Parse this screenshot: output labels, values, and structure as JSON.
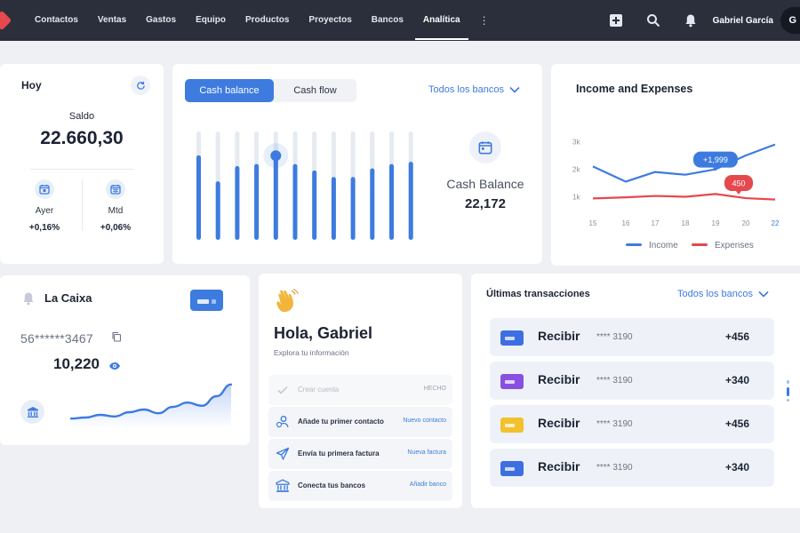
{
  "colors": {
    "accent": "#3d7bdf",
    "income": "#3d7bdf",
    "expenses": "#e5484d",
    "topbar": "#2a2f3b"
  },
  "nav": {
    "items": [
      "Contactos",
      "Ventas",
      "Gastos",
      "Equipo",
      "Productos",
      "Proyectos",
      "Bancos",
      "Analítica"
    ],
    "active": "Analítica",
    "more_icon": "more-vertical-icon"
  },
  "topbar": {
    "icons": [
      "add-icon",
      "search-icon",
      "bell-icon"
    ],
    "user_name": "Gabriel García",
    "avatar_initial": "G"
  },
  "hoy": {
    "title": "Hoy",
    "refresh_icon": "refresh-icon",
    "saldo_label": "Saldo",
    "saldo_value": "22.660,30",
    "stats": [
      {
        "label": "Ayer",
        "value": "+0,16%",
        "icon": "calendar-icon"
      },
      {
        "label": "Mtd",
        "value": "+0,06%",
        "icon": "calendar-grid-icon"
      }
    ]
  },
  "cash": {
    "tabs": [
      "Cash balance",
      "Cash flow"
    ],
    "active_tab": "Cash balance",
    "banks_dropdown": "Todos los bancos",
    "label": "Cash Balance",
    "value": "22,172",
    "bar_levels": [
      0.78,
      0.54,
      0.68,
      0.7,
      0.76,
      0.7,
      0.64,
      0.58,
      0.58,
      0.66,
      0.7,
      0.72
    ],
    "highlighted_bar": 4
  },
  "income": {
    "title": "Income and Expenses",
    "chart_data": {
      "type": "line",
      "x": [
        15,
        16,
        17,
        18,
        19,
        20,
        22
      ],
      "yticks": [
        "3k",
        "2k",
        "1k"
      ],
      "ylim": [
        500,
        3500
      ],
      "series": [
        {
          "name": "Income",
          "values": [
            2100,
            1550,
            1900,
            1800,
            1999,
            2500,
            2900
          ]
        },
        {
          "name": "Expenses",
          "values": [
            940,
            980,
            1030,
            1000,
            1100,
            950,
            900
          ]
        }
      ],
      "annotations": [
        "+1,999",
        "450"
      ],
      "legend": "bottom"
    }
  },
  "caixa": {
    "title": "La Caixa",
    "account": "56******3467",
    "balance": "10,220",
    "sparkline": [
      0.18,
      0.2,
      0.25,
      0.22,
      0.3,
      0.35,
      0.28,
      0.4,
      0.48,
      0.42,
      0.6,
      0.82
    ]
  },
  "hola": {
    "title": "Hola, Gabriel",
    "subtitle": "Explora tu información",
    "tasks": [
      {
        "label": "Crear cuenta",
        "action": "HECHO",
        "icon": "check-icon",
        "done": true
      },
      {
        "label": "Añade tu primer contacto",
        "action": "Nuevo contacto",
        "icon": "contacts-icon",
        "done": false
      },
      {
        "label": "Envía tu primera factura",
        "action": "Nueva factura",
        "icon": "send-icon",
        "done": false
      },
      {
        "label": "Conecta tus bancos",
        "action": "Añadir banco",
        "icon": "bank-icon",
        "done": false
      }
    ]
  },
  "transactions": {
    "title": "Últimas transacciones",
    "banks_dropdown": "Todos los bancos",
    "rows": [
      {
        "type": "Recibir",
        "account": "**** 3190",
        "amount": "+456",
        "card_color": "#3d6fe0"
      },
      {
        "type": "Recibir",
        "account": "**** 3190",
        "amount": "+340",
        "card_color": "#8a4fe0"
      },
      {
        "type": "Recibir",
        "account": "**** 3190",
        "amount": "+456",
        "card_color": "#f2c12e"
      },
      {
        "type": "Recibir",
        "account": "**** 3190",
        "amount": "+340",
        "card_color": "#3d6fe0"
      }
    ]
  }
}
